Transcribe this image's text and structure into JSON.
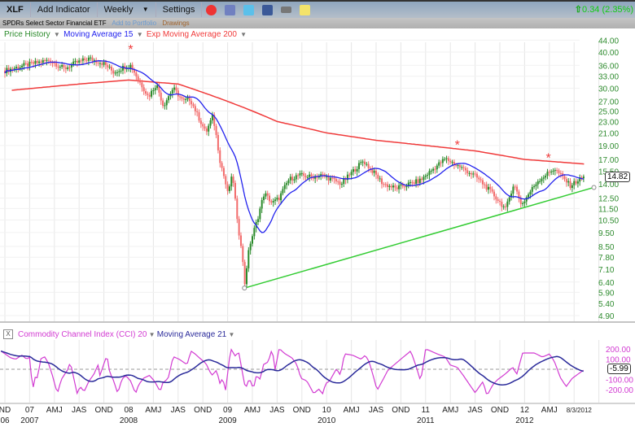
{
  "toolbar": {
    "ticker": "XLF",
    "add_indicator": "Add Indicator",
    "period": "Weekly",
    "settings": "Settings",
    "change": "0.34 (2.35%)"
  },
  "subbar": {
    "name": "SPDRs Select Sector Financial ETF",
    "add_portfolio": "Add to Portfolio",
    "drawings": "Drawings"
  },
  "legend": {
    "price": "Price History",
    "ma": "Moving Average 15",
    "ema": "Exp Moving Average 200"
  },
  "cci_legend": {
    "close": "X",
    "cci": "Commodity Channel Index (CCI) 20",
    "ma": "Moving Average 21"
  },
  "colors": {
    "up": "#2a8a2a",
    "down": "#f26b6b",
    "ma": "#2222ee",
    "ema": "#f03a3a",
    "trend": "#33cc33",
    "cci": "#d23bd2",
    "cci_ma": "#2a2a9a",
    "axis": "#2e8b2e"
  },
  "last_price": "14.82",
  "last_cci": "-5.99",
  "chart_data": [
    {
      "type": "candlestick",
      "title": "XLF Weekly",
      "yscale": "log",
      "ylim": [
        4.6,
        46
      ],
      "y_ticks": [
        "44.00",
        "40.00",
        "36.00",
        "33.00",
        "30.00",
        "27.00",
        "25.00",
        "23.00",
        "21.00",
        "19.00",
        "17.00",
        "15.50",
        "14.00",
        "12.50",
        "11.50",
        "10.50",
        "9.50",
        "8.50",
        "7.80",
        "7.10",
        "6.40",
        "5.90",
        "5.40",
        "4.90"
      ],
      "price_path": [
        [
          2006.75,
          34.5
        ],
        [
          2006.95,
          36
        ],
        [
          2007.2,
          37.5
        ],
        [
          2007.35,
          35
        ],
        [
          2007.45,
          36.5
        ],
        [
          2007.6,
          38
        ],
        [
          2007.75,
          36.5
        ],
        [
          2007.85,
          34
        ],
        [
          2007.95,
          35.5
        ],
        [
          2008.02,
          36
        ],
        [
          2008.1,
          32
        ],
        [
          2008.2,
          28
        ],
        [
          2008.28,
          31
        ],
        [
          2008.35,
          26
        ],
        [
          2008.45,
          30
        ],
        [
          2008.55,
          27
        ],
        [
          2008.62,
          27.5
        ],
        [
          2008.7,
          24
        ],
        [
          2008.78,
          21
        ],
        [
          2008.85,
          24
        ],
        [
          2008.92,
          17
        ],
        [
          2009.0,
          13
        ],
        [
          2009.05,
          15
        ],
        [
          2009.1,
          10
        ],
        [
          2009.14,
          8.5
        ],
        [
          2009.17,
          6.2
        ],
        [
          2009.22,
          8.5
        ],
        [
          2009.3,
          10.5
        ],
        [
          2009.37,
          13
        ],
        [
          2009.45,
          12
        ],
        [
          2009.52,
          12.5
        ],
        [
          2009.62,
          14.5
        ],
        [
          2009.72,
          15
        ],
        [
          2009.85,
          14.8
        ],
        [
          2009.95,
          15
        ],
        [
          2010.15,
          14
        ],
        [
          2010.37,
          16.8
        ],
        [
          2010.57,
          14
        ],
        [
          2010.7,
          13.5
        ],
        [
          2010.95,
          14.4
        ],
        [
          2011.2,
          17.1
        ],
        [
          2011.5,
          14.9
        ],
        [
          2011.67,
          13
        ],
        [
          2011.81,
          11.4
        ],
        [
          2011.89,
          14
        ],
        [
          2011.97,
          11.8
        ],
        [
          2012.13,
          14.3
        ],
        [
          2012.3,
          15.8
        ],
        [
          2012.46,
          13.8
        ],
        [
          2012.6,
          14.82
        ]
      ],
      "ema200": [
        [
          2006.82,
          29.5
        ],
        [
          2007.5,
          31
        ],
        [
          2008.0,
          32
        ],
        [
          2008.5,
          31
        ],
        [
          2009.0,
          27
        ],
        [
          2009.5,
          23
        ],
        [
          2010.0,
          21
        ],
        [
          2010.5,
          19.8
        ],
        [
          2011.0,
          19
        ],
        [
          2011.5,
          18.2
        ],
        [
          2012.0,
          17
        ],
        [
          2012.6,
          16.4
        ]
      ],
      "ma_period": 15,
      "trendline": [
        [
          2009.17,
          6.1
        ],
        [
          2012.7,
          13.6
        ]
      ],
      "asterisks": [
        [
          2008.02,
          41
        ],
        [
          2011.32,
          19.2
        ],
        [
          2012.24,
          17.3
        ]
      ]
    },
    {
      "type": "line",
      "title": "CCI 20",
      "ylim": [
        -260,
        260
      ],
      "y_ticks": [
        "200.00",
        "100.00",
        "-100.00",
        "-200.00"
      ],
      "ma_period": 21,
      "cci": [
        [
          2006.71,
          179
        ],
        [
          2006.81,
          112
        ],
        [
          2006.86,
          99
        ],
        [
          2006.92,
          139
        ],
        [
          2006.97,
          99
        ],
        [
          2007.0,
          120
        ],
        [
          2007.03,
          -208
        ],
        [
          2007.06,
          -61
        ],
        [
          2007.08,
          -90
        ],
        [
          2007.11,
          99
        ],
        [
          2007.15,
          125
        ],
        [
          2007.19,
          59
        ],
        [
          2007.23,
          -61
        ],
        [
          2007.28,
          -240
        ],
        [
          2007.32,
          -101
        ],
        [
          2007.39,
          5
        ],
        [
          2007.41,
          72
        ],
        [
          2007.44,
          -61
        ],
        [
          2007.48,
          -240
        ],
        [
          2007.51,
          -168
        ],
        [
          2007.55,
          -221
        ],
        [
          2007.6,
          -115
        ],
        [
          2007.65,
          -48
        ],
        [
          2007.69,
          45
        ],
        [
          2007.71,
          -61
        ],
        [
          2007.78,
          139
        ],
        [
          2007.81,
          -35
        ],
        [
          2007.85,
          -115
        ],
        [
          2007.89,
          -240
        ],
        [
          2007.93,
          -101
        ],
        [
          2007.97,
          -61
        ],
        [
          2008.02,
          -115
        ],
        [
          2008.07,
          -240
        ],
        [
          2008.1,
          -155
        ],
        [
          2008.15,
          -88
        ],
        [
          2008.21,
          -61
        ],
        [
          2008.26,
          -115
        ],
        [
          2008.32,
          -221
        ],
        [
          2008.34,
          -141
        ],
        [
          2008.4,
          -88
        ],
        [
          2008.45,
          125
        ],
        [
          2008.51,
          99
        ],
        [
          2008.59,
          45
        ],
        [
          2008.63,
          179
        ],
        [
          2008.67,
          152
        ],
        [
          2008.73,
          99
        ],
        [
          2008.78,
          59
        ],
        [
          2008.84,
          -61
        ],
        [
          2008.89,
          -8
        ],
        [
          2008.92,
          -141
        ],
        [
          2008.95,
          -88
        ],
        [
          2008.98,
          -208
        ],
        [
          2009.03,
          205
        ],
        [
          2009.08,
          125
        ],
        [
          2009.11,
          179
        ],
        [
          2009.14,
          19
        ],
        [
          2009.18,
          -195
        ],
        [
          2009.22,
          -88
        ],
        [
          2009.26,
          -195
        ],
        [
          2009.29,
          -61
        ],
        [
          2009.33,
          -101
        ],
        [
          2009.36,
          45
        ],
        [
          2009.41,
          72
        ],
        [
          2009.45,
          205
        ],
        [
          2009.48,
          -8
        ],
        [
          2009.52,
          205
        ],
        [
          2009.58,
          152
        ],
        [
          2009.65,
          112
        ],
        [
          2009.7,
          45
        ],
        [
          2009.74,
          -88
        ],
        [
          2009.8,
          -115
        ],
        [
          2009.87,
          -240
        ],
        [
          2009.92,
          -195
        ],
        [
          2009.96,
          -240
        ],
        [
          2009.99,
          -141
        ],
        [
          2010.03,
          -115
        ],
        [
          2010.1,
          5
        ],
        [
          2010.14,
          -61
        ],
        [
          2010.18,
          152
        ],
        [
          2010.26,
          139
        ],
        [
          2010.35,
          99
        ],
        [
          2010.39,
          139
        ],
        [
          2010.43,
          72
        ],
        [
          2010.47,
          -61
        ],
        [
          2010.51,
          -208
        ],
        [
          2010.57,
          -101
        ],
        [
          2010.62,
          -8
        ]
      ]
    }
  ],
  "x_axis": {
    "row1": [
      [
        "ND",
        2006.75
      ],
      [
        "07",
        2007.0
      ],
      [
        "AMJ",
        2007.25
      ],
      [
        "JAS",
        2007.5
      ],
      [
        "OND",
        2007.75
      ],
      [
        "08",
        2008.0
      ],
      [
        "AMJ",
        2008.25
      ],
      [
        "JAS",
        2008.5
      ],
      [
        "OND",
        2008.75
      ],
      [
        "09",
        2009.0
      ],
      [
        "AMJ",
        2009.25
      ],
      [
        "JAS",
        2009.5
      ],
      [
        "OND",
        2009.75
      ],
      [
        "10",
        2010.0
      ],
      [
        "AMJ",
        2010.25
      ],
      [
        "JAS",
        2010.5
      ],
      [
        "OND",
        2010.75
      ],
      [
        "11",
        2011.0
      ],
      [
        "AMJ",
        2011.25
      ],
      [
        "JAS",
        2011.5
      ],
      [
        "OND",
        2011.75
      ],
      [
        "12",
        2012.0
      ],
      [
        "AMJ",
        2012.25
      ],
      [
        "8/3/2012",
        2012.55
      ]
    ],
    "row2": [
      [
        "06",
        2006.75
      ],
      [
        "2007",
        2007.0
      ],
      [
        "2008",
        2008.0
      ],
      [
        "2009",
        2009.0
      ],
      [
        "2010",
        2010.0
      ],
      [
        "2011",
        2011.0
      ],
      [
        "2012",
        2012.0
      ]
    ]
  }
}
